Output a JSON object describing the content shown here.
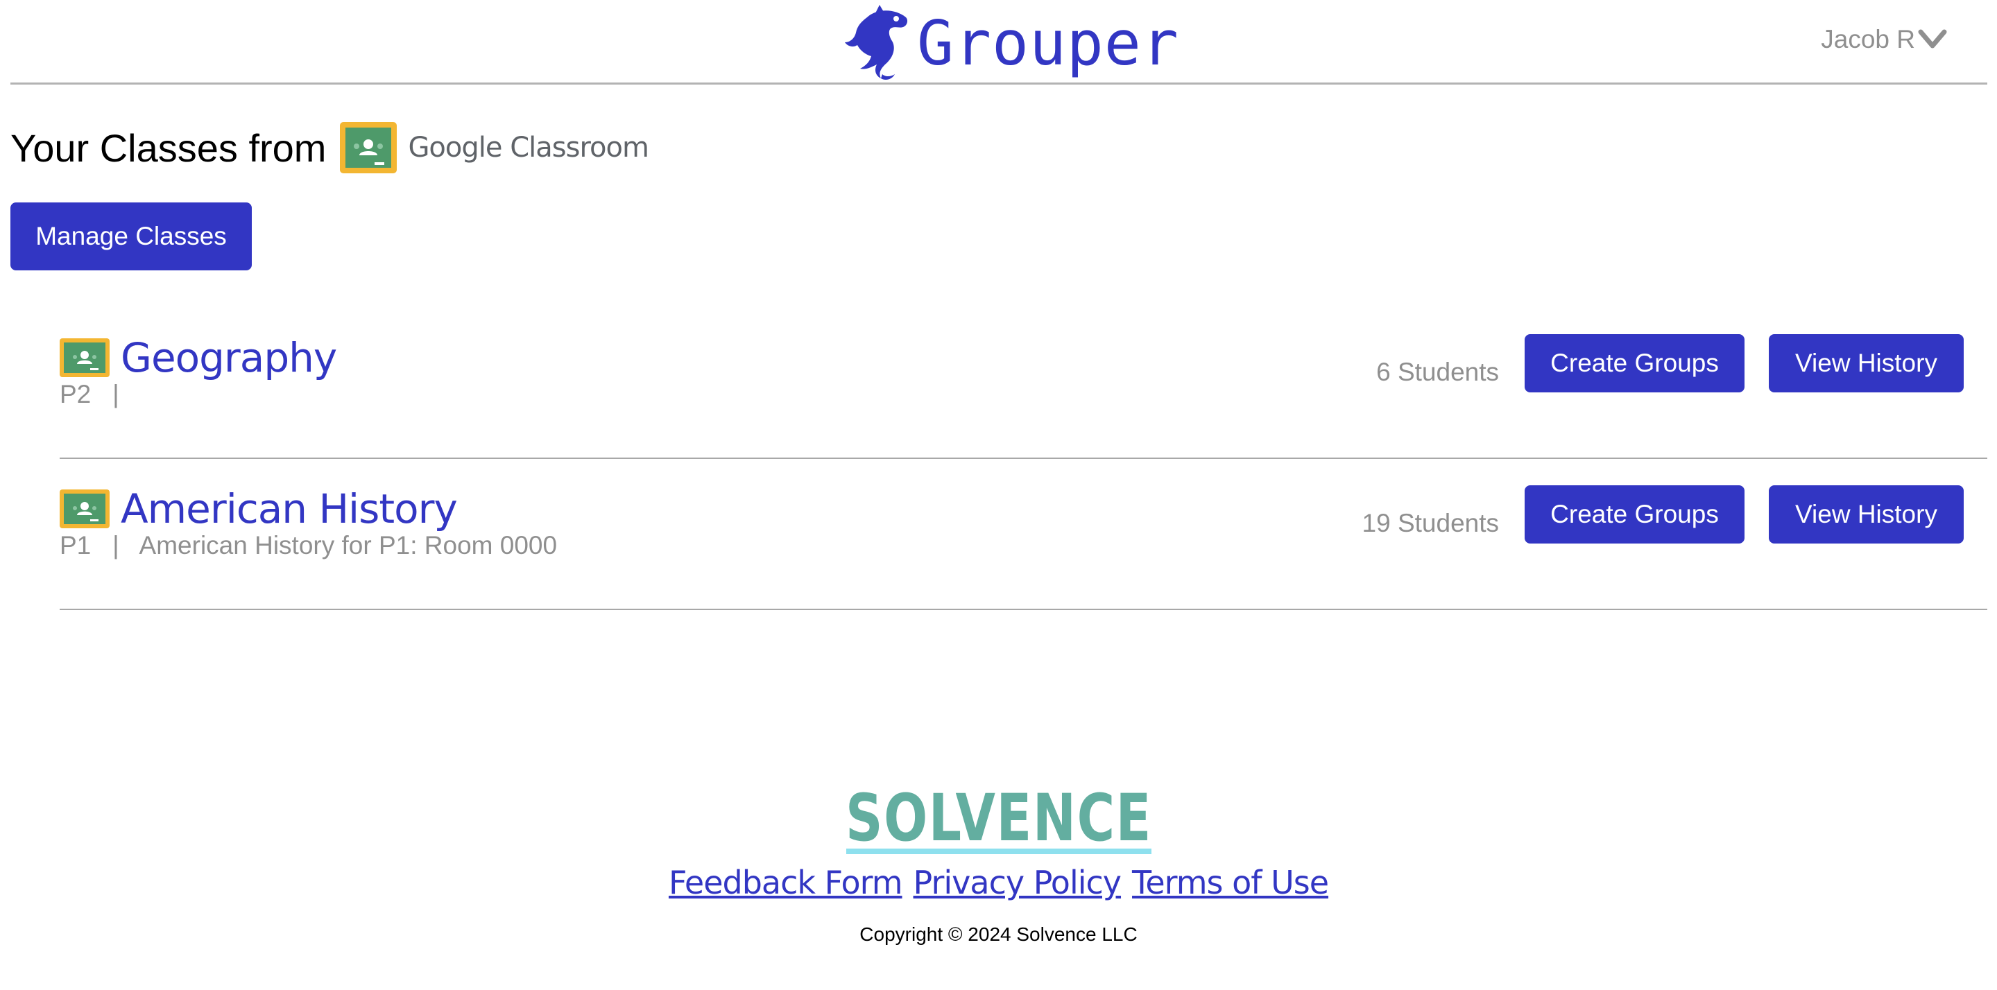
{
  "header": {
    "app_name": "Grouper",
    "user_name": "Jacob R",
    "brand_color": "#3236c3"
  },
  "main": {
    "heading": "Your Classes from",
    "classroom_brand": "Google Classroom",
    "manage_label": "Manage Classes",
    "classes": [
      {
        "name": "Geography",
        "period": "P2",
        "separator": "|",
        "description": "",
        "students": "6 Students",
        "create_label": "Create Groups",
        "history_label": "View History"
      },
      {
        "name": "American History",
        "period": "P1",
        "separator": "|",
        "description": "American History for P1: Room 0000",
        "students": "19 Students",
        "create_label": "Create Groups",
        "history_label": "View History"
      }
    ]
  },
  "footer": {
    "company_logo_text": "SOLVENCE",
    "links": [
      "Feedback Form",
      "Privacy Policy",
      "Terms of Use"
    ],
    "copyright": "Copyright © 2024 Solvence LLC"
  },
  "icons": {
    "brand_logo": "fish-icon",
    "user_menu": "chevron-down-icon",
    "classroom": "google-classroom-icon"
  },
  "colors": {
    "accent": "#3236c3",
    "muted_text": "#8f8f8f",
    "solvence_teal": "#63aea0",
    "solvence_underline": "#8ee0ee",
    "classroom_frame": "#f3b632",
    "classroom_board": "#4e9a6a"
  }
}
